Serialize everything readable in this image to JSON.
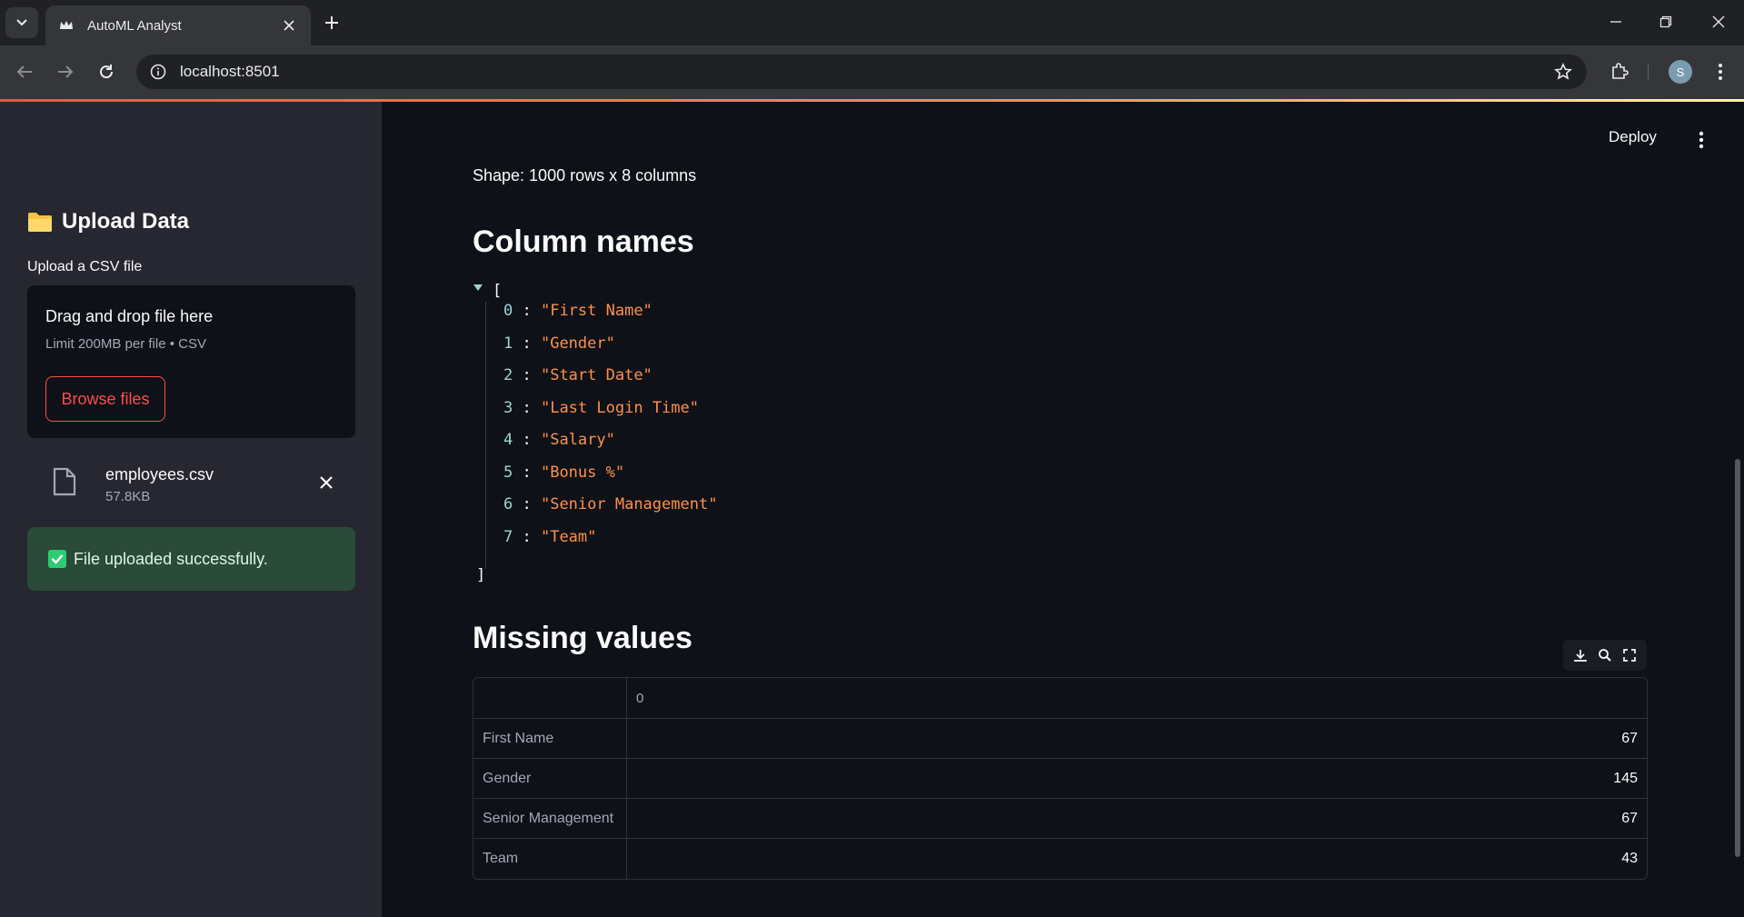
{
  "browser": {
    "tab_title": "AutoML Analyst",
    "url": "localhost:8501",
    "profile_initial": "S"
  },
  "sidebar": {
    "title": "Upload Data",
    "upload_label": "Upload a CSV file",
    "dropzone": {
      "title": "Drag and drop file here",
      "subtitle": "Limit 200MB per file • CSV",
      "browse_label": "Browse files"
    },
    "file": {
      "name": "employees.csv",
      "size": "57.8KB"
    },
    "success_message": "File uploaded successfully."
  },
  "header": {
    "deploy_label": "Deploy"
  },
  "main": {
    "shape_text": "Shape: 1000 rows x 8 columns",
    "columns_heading": "Column names",
    "json_open": "[",
    "json_close": "]",
    "columns": [
      {
        "index": "0",
        "value": "\"First Name\""
      },
      {
        "index": "1",
        "value": "\"Gender\""
      },
      {
        "index": "2",
        "value": "\"Start Date\""
      },
      {
        "index": "3",
        "value": "\"Last Login Time\""
      },
      {
        "index": "4",
        "value": "\"Salary\""
      },
      {
        "index": "5",
        "value": "\"Bonus %\""
      },
      {
        "index": "6",
        "value": "\"Senior Management\""
      },
      {
        "index": "7",
        "value": "\"Team\""
      }
    ],
    "missing_heading": "Missing values",
    "missing_table": {
      "header": "0",
      "rows": [
        {
          "label": "First Name",
          "value": "67"
        },
        {
          "label": "Gender",
          "value": "145"
        },
        {
          "label": "Senior Management",
          "value": "67"
        },
        {
          "label": "Team",
          "value": "43"
        }
      ]
    }
  },
  "colors": {
    "accent": "#ff4b4b",
    "json_value": "#ff8f4b",
    "json_key": "#9ad6d6",
    "success_bg": "#2b4b3a"
  }
}
